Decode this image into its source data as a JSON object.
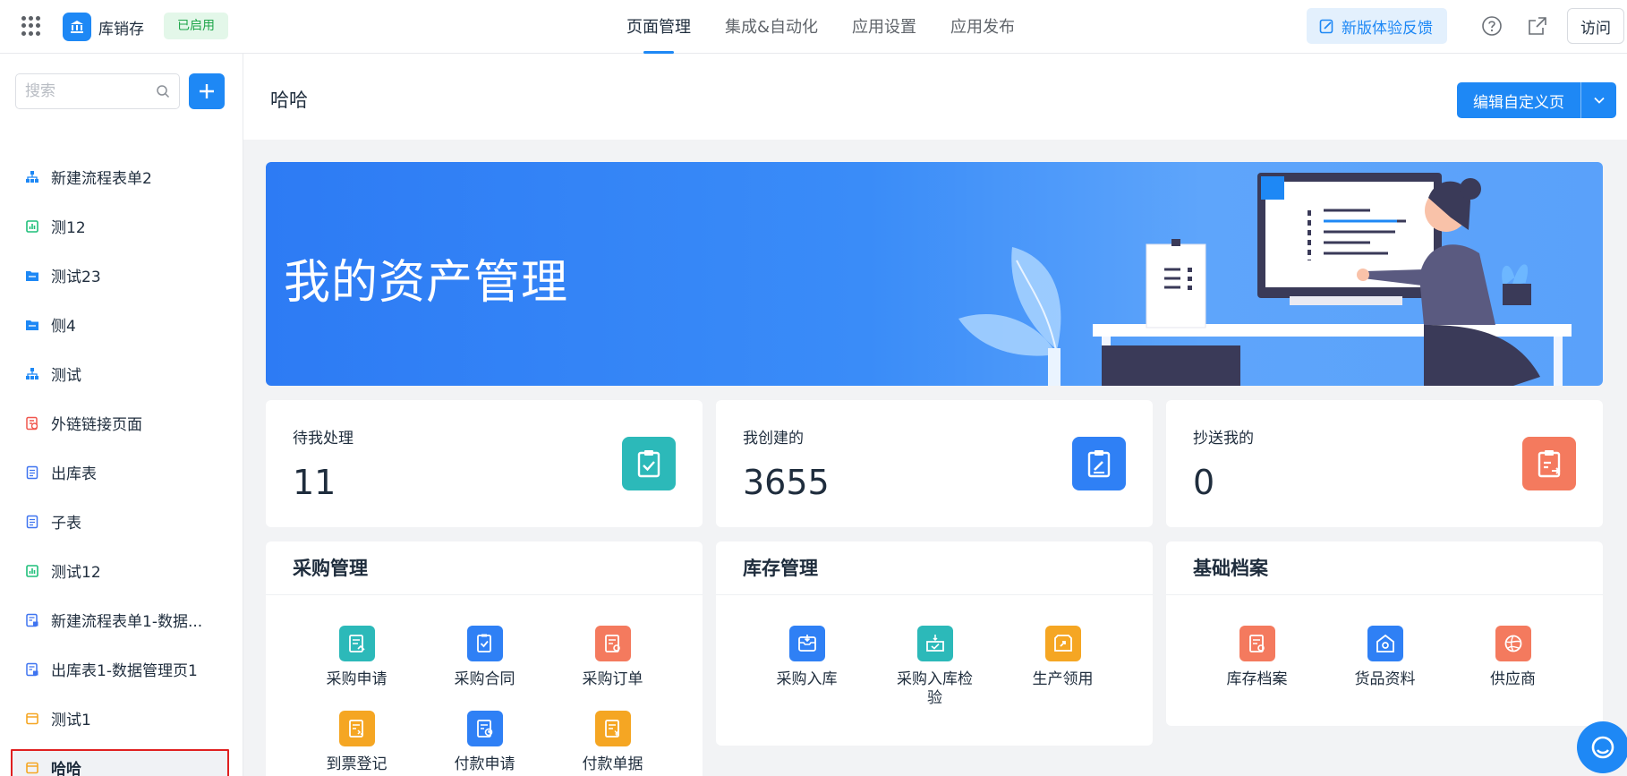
{
  "app": {
    "name": "库销存",
    "status": "已启用"
  },
  "nav": {
    "tabs": [
      "页面管理",
      "集成&自动化",
      "应用设置",
      "应用发布"
    ],
    "active": 0
  },
  "header_actions": {
    "feedback": "新版体验反馈",
    "visit": "访问"
  },
  "sidebar": {
    "search_placeholder": "搜索",
    "items": [
      {
        "label": "新建流程表单2",
        "icon": "flow-icon",
        "color": "#1e88f5"
      },
      {
        "label": "测12",
        "icon": "report-icon",
        "color": "#1fbf7a"
      },
      {
        "label": "测试23",
        "icon": "folder-icon",
        "color": "#1e88f5"
      },
      {
        "label": "侧4",
        "icon": "folder-icon",
        "color": "#1e88f5"
      },
      {
        "label": "测试",
        "icon": "flow-icon",
        "color": "#1e88f5"
      },
      {
        "label": "外链链接页面",
        "icon": "link-page-icon",
        "color": "#f0564d"
      },
      {
        "label": "出库表",
        "icon": "form-icon",
        "color": "#3f74f0"
      },
      {
        "label": "子表",
        "icon": "form-icon",
        "color": "#3f74f0"
      },
      {
        "label": "测试12",
        "icon": "report-icon",
        "color": "#1fbf7a"
      },
      {
        "label": "新建流程表单1-数据...",
        "icon": "data-page-icon",
        "color": "#3f74f0"
      },
      {
        "label": "出库表1-数据管理页1",
        "icon": "data-page-icon",
        "color": "#3f74f0"
      },
      {
        "label": "测试1",
        "icon": "custom-page-icon",
        "color": "#f5a623"
      },
      {
        "label": "哈哈",
        "icon": "custom-page-icon",
        "color": "#f5a623",
        "selected": true
      }
    ]
  },
  "page": {
    "title": "哈哈",
    "edit_button": "编辑自定义页"
  },
  "banner": {
    "title": "我的资产管理"
  },
  "stats": [
    {
      "label": "待我处理",
      "value": "11",
      "icon": "todo-clipboard-icon",
      "color": "#2cb9b9"
    },
    {
      "label": "我创建的",
      "value": "3655",
      "icon": "edit-doc-icon",
      "color": "#2f80f5"
    },
    {
      "label": "抄送我的",
      "value": "0",
      "icon": "cc-doc-icon",
      "color": "#f47a5e"
    }
  ],
  "sections": [
    {
      "title": "采购管理",
      "items": [
        {
          "label": "采购申请",
          "icon": "apply-icon",
          "color": "#2cb9b9"
        },
        {
          "label": "采购合同",
          "icon": "contract-icon",
          "color": "#2f80f5"
        },
        {
          "label": "采购订单",
          "icon": "order-icon",
          "color": "#f47a5e"
        },
        {
          "label": "到票登记",
          "icon": "invoice-icon",
          "color": "#f5a623"
        },
        {
          "label": "付款申请",
          "icon": "payment-apply-icon",
          "color": "#2f80f5"
        },
        {
          "label": "付款单据",
          "icon": "payment-doc-icon",
          "color": "#f5a623"
        }
      ]
    },
    {
      "title": "库存管理",
      "items": [
        {
          "label": "采购入库",
          "icon": "inbound-icon",
          "color": "#2f80f5"
        },
        {
          "label": "采购入库检验",
          "icon": "inspect-icon",
          "color": "#2cb9b9"
        },
        {
          "label": "生产领用",
          "icon": "production-icon",
          "color": "#f5a623"
        }
      ]
    },
    {
      "title": "基础档案",
      "items": [
        {
          "label": "库存档案",
          "icon": "archive-icon",
          "color": "#f47a5e"
        },
        {
          "label": "货品资料",
          "icon": "goods-icon",
          "color": "#2f80f5"
        },
        {
          "label": "供应商",
          "icon": "supplier-icon",
          "color": "#f47a5e"
        }
      ]
    }
  ]
}
